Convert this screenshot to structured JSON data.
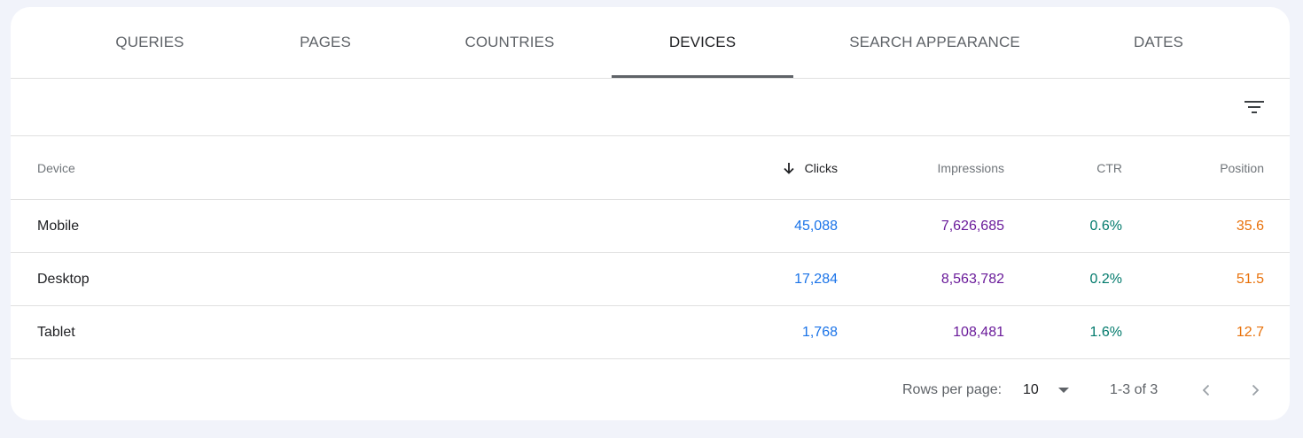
{
  "tabs": [
    {
      "label": "QUERIES"
    },
    {
      "label": "PAGES"
    },
    {
      "label": "COUNTRIES"
    },
    {
      "label": "DEVICES",
      "active": true
    },
    {
      "label": "SEARCH APPEARANCE"
    },
    {
      "label": "DATES"
    }
  ],
  "filter": {
    "icon": "filter-list-icon"
  },
  "table": {
    "headers": {
      "device": "Device",
      "clicks": "Clicks",
      "impressions": "Impressions",
      "ctr": "CTR",
      "position": "Position"
    },
    "sort_icon": "arrow-down-icon",
    "rows": [
      {
        "device": "Mobile",
        "clicks": "45,088",
        "impressions": "7,626,685",
        "ctr": "0.6%",
        "position": "35.6"
      },
      {
        "device": "Desktop",
        "clicks": "17,284",
        "impressions": "8,563,782",
        "ctr": "0.2%",
        "position": "51.5"
      },
      {
        "device": "Tablet",
        "clicks": "1,768",
        "impressions": "108,481",
        "ctr": "1.6%",
        "position": "12.7"
      }
    ]
  },
  "pagination": {
    "rows_per_page_label": "Rows per page:",
    "rows_per_page_value": "10",
    "range": "1-3 of 3",
    "prev_icon": "chevron-left-icon",
    "next_icon": "chevron-right-icon"
  },
  "colors": {
    "clicks": "#1a73e8",
    "impressions": "#6a1b9a",
    "ctr": "#00796b",
    "position": "#e8710a"
  }
}
